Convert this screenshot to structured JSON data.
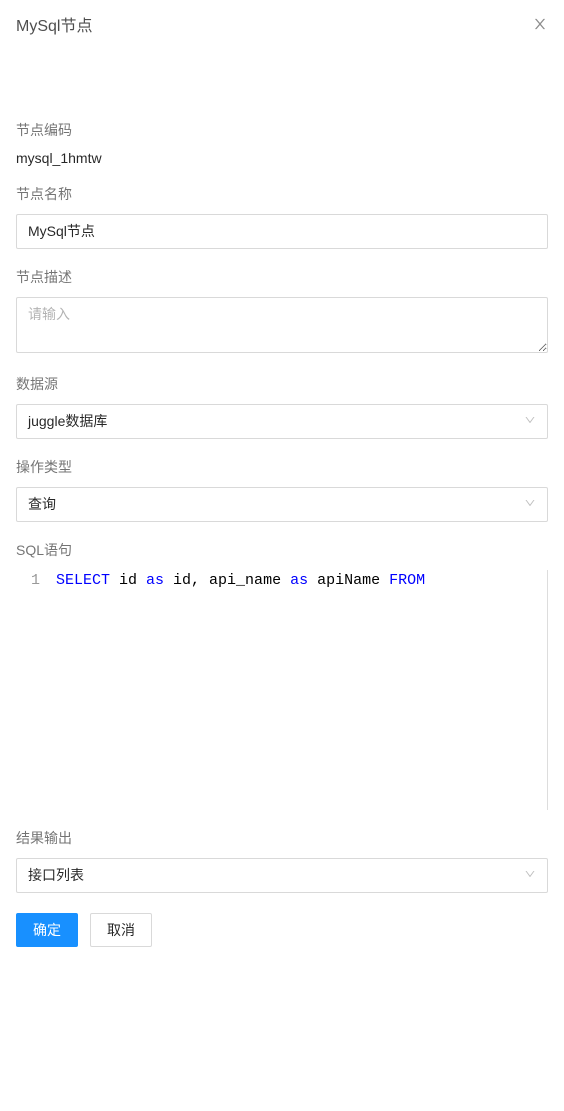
{
  "modal": {
    "title": "MySql节点"
  },
  "form": {
    "node_code": {
      "label": "节点编码",
      "value": "mysql_1hmtw"
    },
    "node_name": {
      "label": "节点名称",
      "value": "MySql节点"
    },
    "node_desc": {
      "label": "节点描述",
      "placeholder": "请输入"
    },
    "datasource": {
      "label": "数据源",
      "value": "juggle数据库"
    },
    "op_type": {
      "label": "操作类型",
      "value": "查询"
    },
    "sql": {
      "label": "SQL语句",
      "line_no": "1",
      "tokens": {
        "t1": "SELECT",
        "t2": " id ",
        "t3": "as",
        "t4": " id, api_name ",
        "t5": "as",
        "t6": " apiName ",
        "t7": "FROM"
      }
    },
    "result": {
      "label": "结果输出",
      "value": "接口列表"
    }
  },
  "buttons": {
    "ok": "确定",
    "cancel": "取消"
  }
}
